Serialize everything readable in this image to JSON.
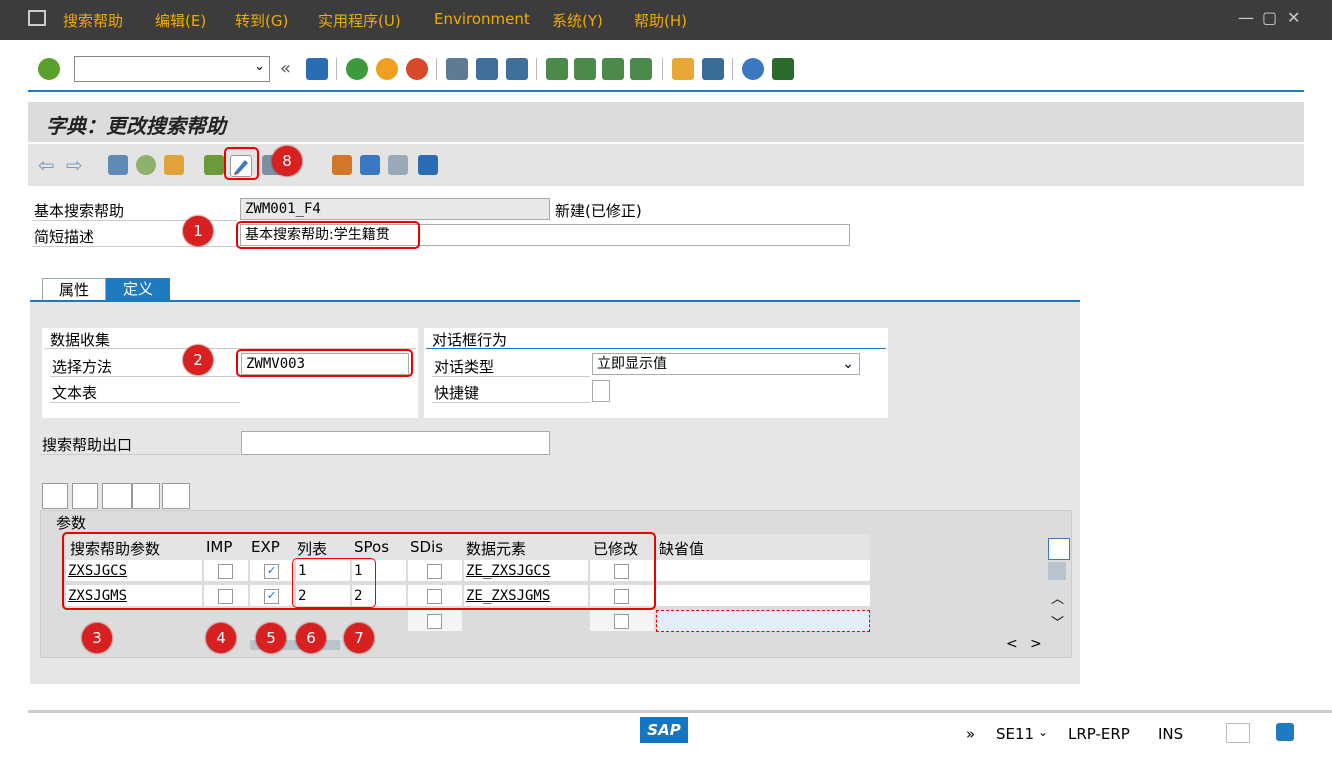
{
  "menu": [
    "搜索帮助",
    "编辑(E)",
    "转到(G)",
    "实用程序(U)",
    "Environment",
    "系统(Y)",
    "帮助(H)"
  ],
  "window_controls": [
    "—",
    "▢",
    "✕"
  ],
  "toolbar": {
    "command_value": "",
    "history_glyph": "«"
  },
  "title": "字典：更改搜索帮助",
  "header": {
    "name_label": "基本搜索帮助",
    "name_value": "ZWM001_F4",
    "status": "新建(已修正)",
    "desc_label": "简短描述",
    "desc_value": "基本搜索帮助:学生籍贯"
  },
  "tabs": [
    "属性",
    "定义"
  ],
  "data_collection": {
    "title": "数据收集",
    "method_label": "选择方法",
    "method_value": "ZWMV003",
    "texttable_label": "文本表"
  },
  "dialog": {
    "title": "对话框行为",
    "type_label": "对话类型",
    "type_value": "立即显示值",
    "hotkey_label": "快捷键"
  },
  "exit_label": "搜索帮助出口",
  "params": {
    "title": "参数",
    "columns": [
      "搜索帮助参数",
      "IMP",
      "EXP",
      "列表",
      "SPos",
      "SDis",
      "数据元素",
      "已修改",
      "缺省值"
    ],
    "rows": [
      {
        "param": "ZXSJGCS",
        "imp": false,
        "exp": true,
        "list": "1",
        "spos": "1",
        "sdis": false,
        "element": "ZE_ZXSJGCS",
        "modified": false,
        "default": ""
      },
      {
        "param": "ZXSJGMS",
        "imp": false,
        "exp": true,
        "list": "2",
        "spos": "2",
        "sdis": false,
        "element": "ZE_ZXSJGMS",
        "modified": false,
        "default": ""
      }
    ]
  },
  "markers": [
    "1",
    "2",
    "3",
    "4",
    "5",
    "6",
    "7",
    "8"
  ],
  "statusbar": {
    "more": "»",
    "tcode": "SE11",
    "system": "LRP-ERP",
    "mode": "INS",
    "logo": "SAP"
  },
  "colors": {
    "menubar": "#3c3c3c",
    "menu_text": "#f0ab00",
    "accent": "#1f7bbf",
    "marker": "#d92020",
    "highlight": "#e00000"
  },
  "icons": [
    "enter-icon",
    "save-icon",
    "back-icon",
    "exit-icon",
    "cancel-icon",
    "print-icon",
    "find-icon",
    "find-next-icon",
    "first-page-icon",
    "prev-page-icon",
    "next-page-icon",
    "last-page-icon",
    "new-session-icon",
    "shortcut-icon",
    "help-icon",
    "customize-icon"
  ]
}
